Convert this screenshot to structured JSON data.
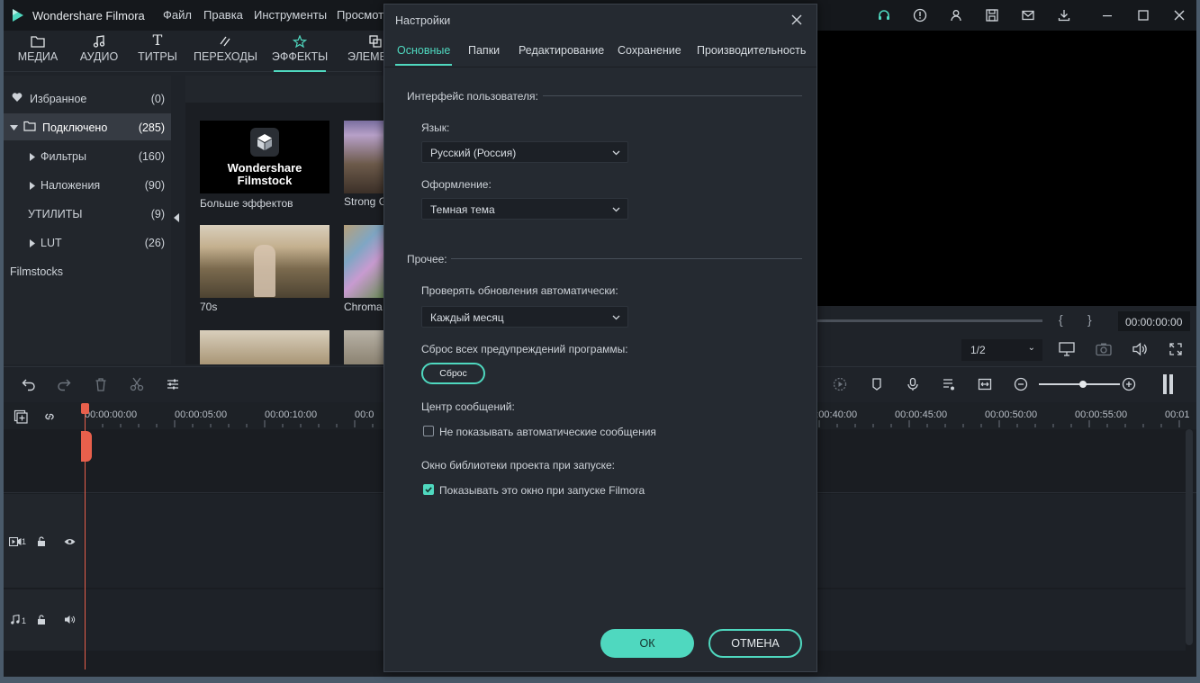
{
  "app": {
    "title": "Wondershare Filmora",
    "menu": [
      "Файл",
      "Правка",
      "Инструменты",
      "Просмот"
    ]
  },
  "tabs": [
    {
      "label": "МЕДИА",
      "icon": "folder-icon"
    },
    {
      "label": "АУДИО",
      "icon": "music-note-icon"
    },
    {
      "label": "ТИТРЫ",
      "icon": "title-t-icon"
    },
    {
      "label": "ПЕРЕХОДЫ",
      "icon": "transition-icon"
    },
    {
      "label": "ЭФФЕКТЫ",
      "icon": "effects-icon",
      "active": true
    },
    {
      "label": "ЭЛЕМЕ",
      "icon": "elements-icon"
    }
  ],
  "sidebar": {
    "items": [
      {
        "label": "Избранное",
        "count": "(0)"
      },
      {
        "label": "Подключено",
        "count": "(285)"
      },
      {
        "label": "Фильтры",
        "count": "(160)"
      },
      {
        "label": "Наложения",
        "count": "(90)"
      },
      {
        "label": "УТИЛИТЫ",
        "count": "(9)"
      },
      {
        "label": "LUT",
        "count": "(26)"
      },
      {
        "label": "Filmstocks",
        "count": ""
      }
    ]
  },
  "browser": {
    "thumbs": [
      {
        "label": "Больше эффектов",
        "logo_line1": "Wondershare",
        "logo_line2": "Filmstock"
      },
      {
        "label": "Strong G"
      },
      {
        "label": "70s"
      },
      {
        "label": "Chroma"
      }
    ]
  },
  "preview": {
    "timecode": "00:00:00:00",
    "page": "1/2"
  },
  "timeline": {
    "ticks": [
      "00:00:00:00",
      "00:00:05:00",
      "00:00:10:00",
      "00:0",
      "00:00:40:00",
      "00:00:45:00",
      "00:00:50:00",
      "00:00:55:00",
      "00:01"
    ],
    "video_track": "1",
    "audio_track": "1"
  },
  "dialog": {
    "title": "Настройки",
    "tabs": [
      "Основные",
      "Папки",
      "Редактирование",
      "Сохранение",
      "Производительность"
    ],
    "ui_section": "Интерфейс пользователя:",
    "language_label": "Язык:",
    "language_value": "Русский (Россия)",
    "theme_label": "Оформление:",
    "theme_value": "Темная тема",
    "other_section": "Прочее:",
    "updates_label": "Проверять обновления автоматически:",
    "updates_value": "Каждый месяц",
    "reset_label": "Сброс всех предупреждений программы:",
    "reset_button": "Сброс",
    "messages_label": "Центр сообщений:",
    "messages_checkbox": "Не показывать автоматические сообщения",
    "messages_checked": false,
    "library_label": "Окно библиотеки проекта при запуске:",
    "library_checkbox": "Показывать это окно при запуске Filmora",
    "library_checked": true,
    "ok": "ОК",
    "cancel": "ОТМЕНА"
  },
  "colors": {
    "accent": "#4fd8bf",
    "playhead": "#e8604c"
  }
}
